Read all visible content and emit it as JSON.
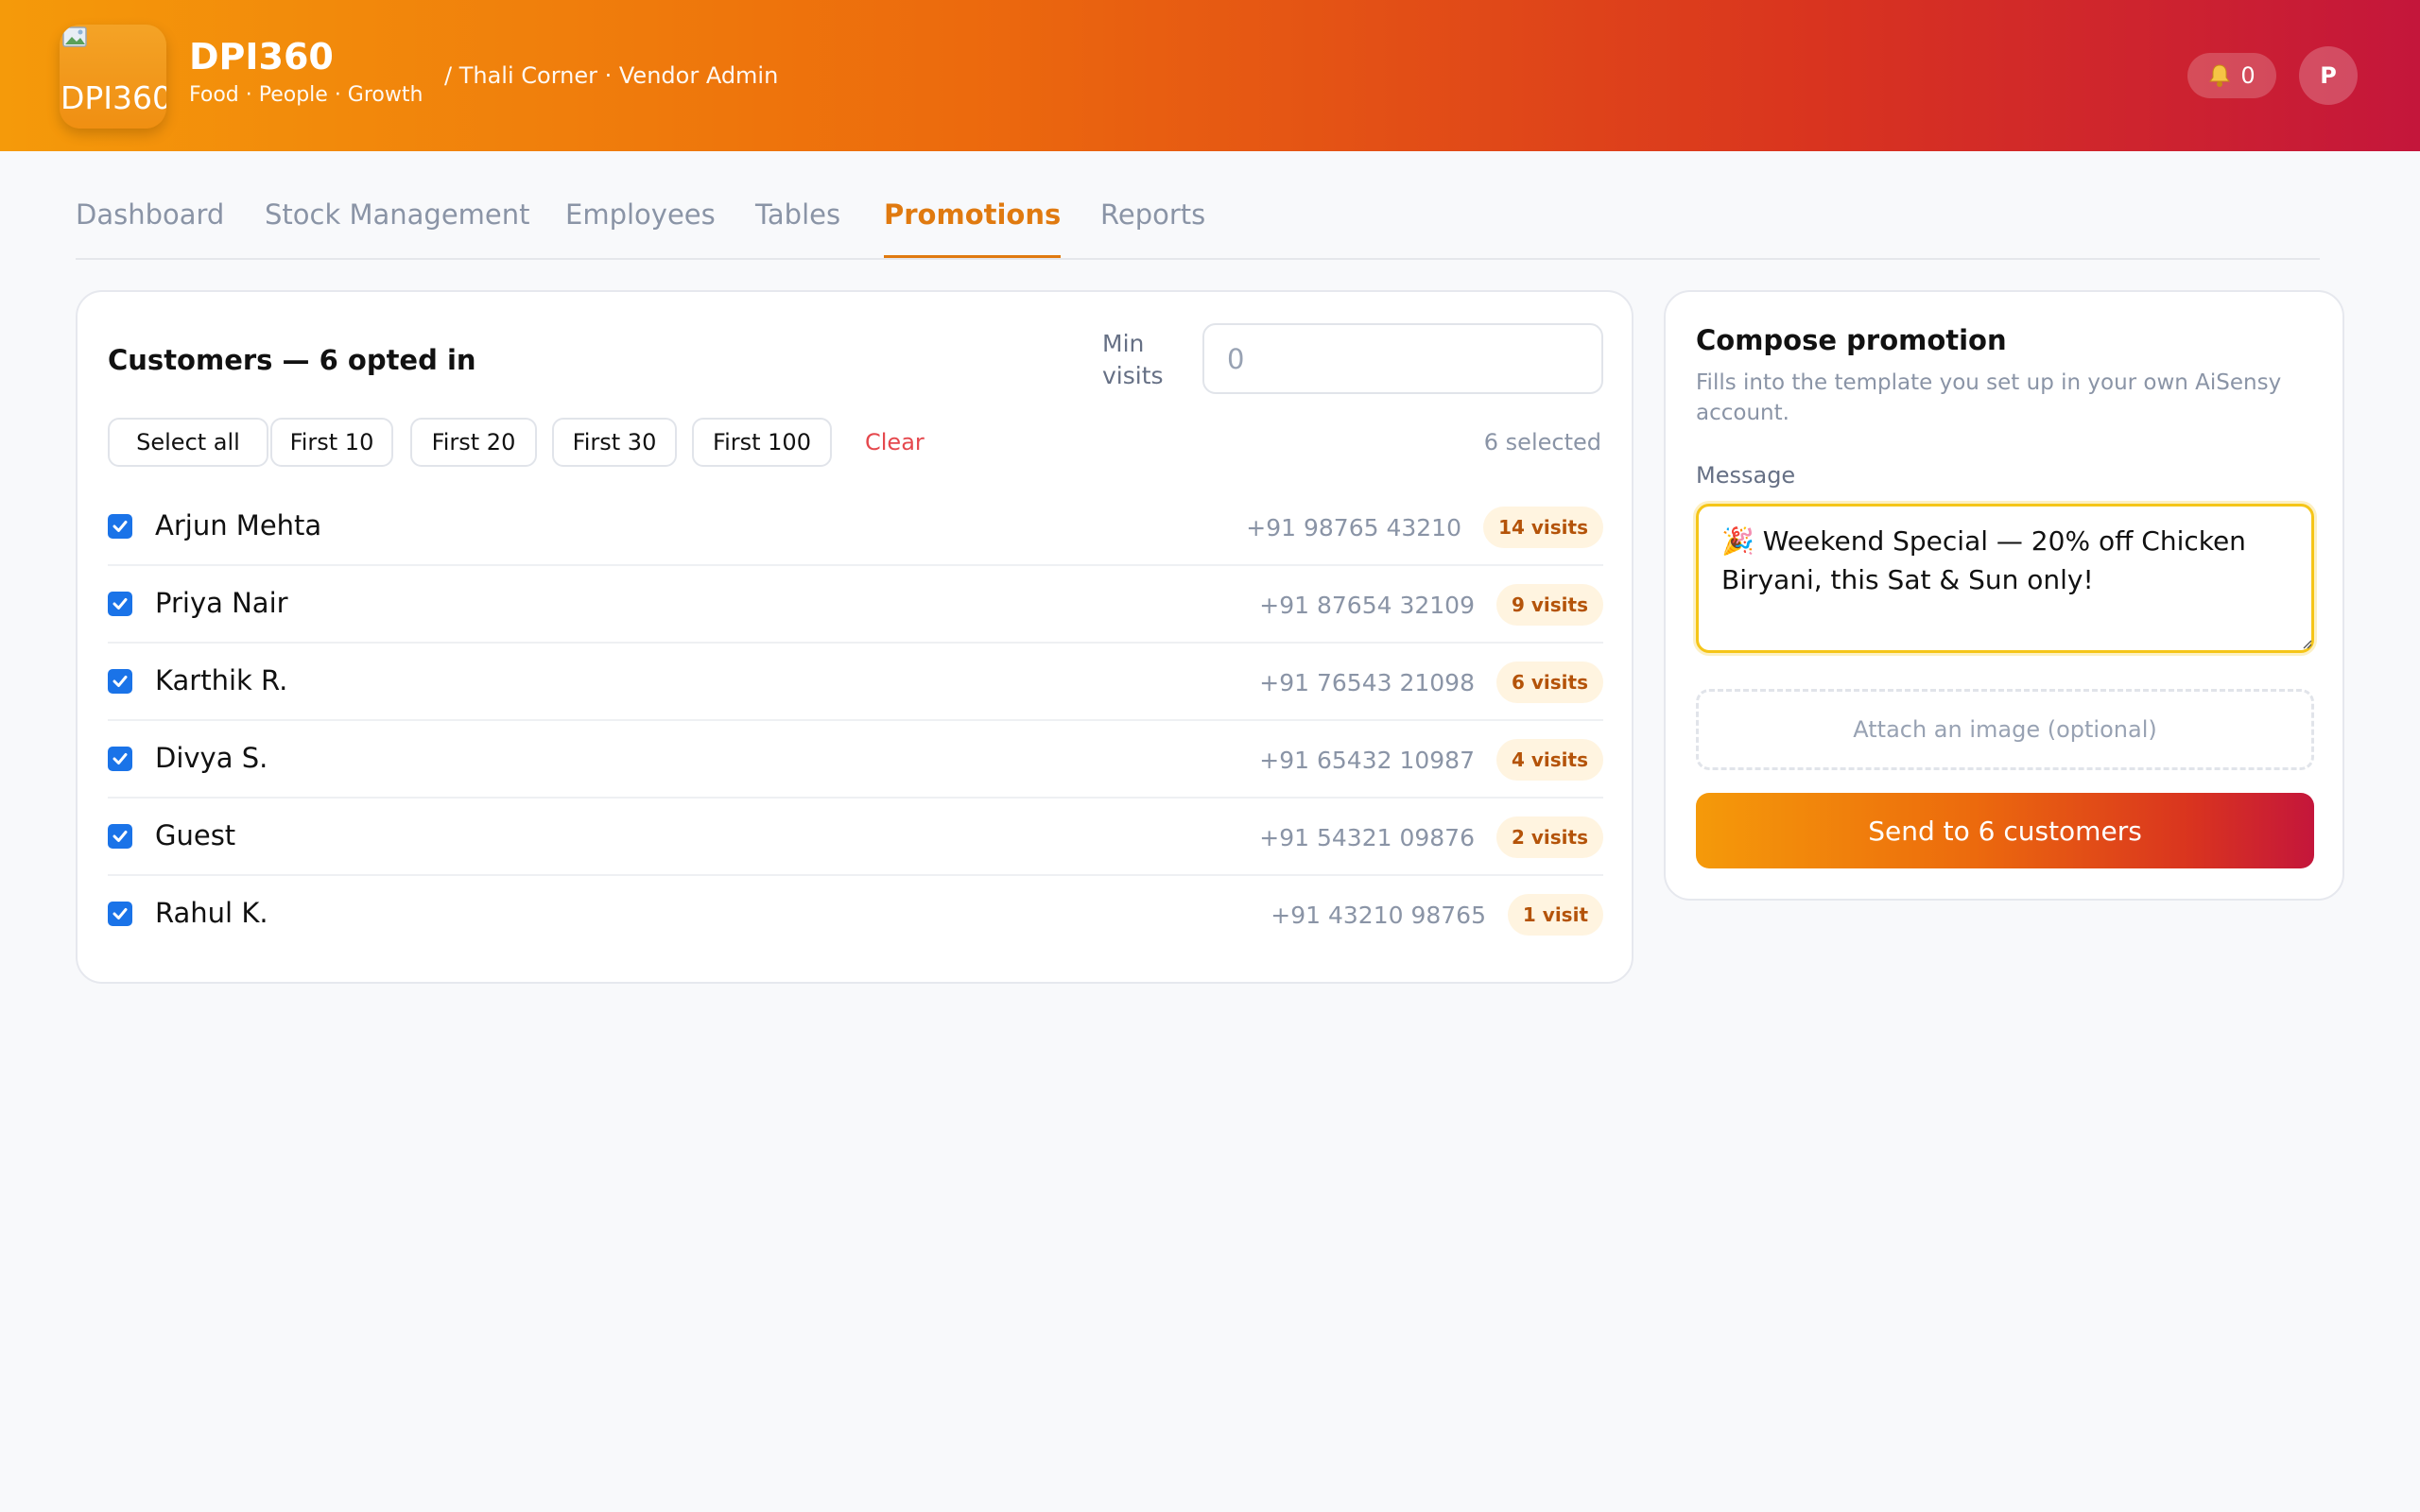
{
  "header": {
    "logo_alt": "DPI360",
    "brand": "DPI360",
    "tagline": "Food · People · Growth",
    "breadcrumb": "/ Thali Corner · Vendor Admin",
    "notifications_count": "0",
    "avatar_initial": "P",
    "gradient_colors": [
      "#f59a0a",
      "#c4163b"
    ]
  },
  "tabs": [
    {
      "label": "Dashboard",
      "active": false
    },
    {
      "label": "Stock Management",
      "active": false
    },
    {
      "label": "Employees",
      "active": false
    },
    {
      "label": "Tables",
      "active": false
    },
    {
      "label": "Promotions",
      "active": true
    },
    {
      "label": "Reports",
      "active": false
    }
  ],
  "customers": {
    "title": "Customers — 6 opted in",
    "min_visits_label": "Min visits",
    "min_visits_placeholder": "0",
    "chips": [
      "Select all",
      "First 10",
      "First 20",
      "First 30",
      "First 100"
    ],
    "clear_label": "Clear",
    "selected_text": "6 selected",
    "rows": [
      {
        "name": "Arjun Mehta",
        "phone": "+91 98765 43210",
        "visits": "14 visits",
        "checked": true
      },
      {
        "name": "Priya Nair",
        "phone": "+91 87654 32109",
        "visits": "9 visits",
        "checked": true
      },
      {
        "name": "Karthik R.",
        "phone": "+91 76543 21098",
        "visits": "6 visits",
        "checked": true
      },
      {
        "name": "Divya S.",
        "phone": "+91 65432 10987",
        "visits": "4 visits",
        "checked": true
      },
      {
        "name": "Guest",
        "phone": "+91 54321 09876",
        "visits": "2 visits",
        "checked": true
      },
      {
        "name": "Rahul K.",
        "phone": "+91 43210 98765",
        "visits": "1 visit",
        "checked": true
      }
    ]
  },
  "compose": {
    "title": "Compose promotion",
    "subtitle": "Fills into the template you set up in your own AiSensy account.",
    "message_label": "Message",
    "message": "🎉 Weekend Special — 20% off Chicken Biryani, this Sat & Sun only!",
    "attach_label": "Attach an image (optional)",
    "send_label": "Send to 6 customers"
  },
  "colors": {
    "accent": "#e07a10",
    "checkbox": "#1a73e8",
    "clear": "#e5484d",
    "badge_bg": "#fff4e0",
    "badge_text": "#b45309"
  }
}
